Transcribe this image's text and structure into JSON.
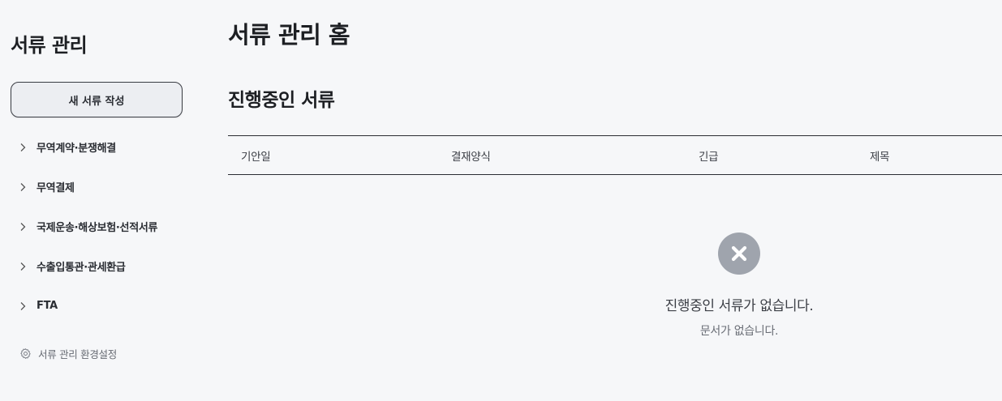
{
  "sidebar": {
    "title": "서류 관리",
    "new_button": "새 서류 작성",
    "items": [
      {
        "label": "무역계약·분쟁해결",
        "icon": "chevron-right-icon"
      },
      {
        "label": "무역결제",
        "icon": "chevron-right-icon"
      },
      {
        "label": "국제운송·해상보험·선적서류",
        "icon": "chevron-right-icon"
      },
      {
        "label": "수출입통관·관세환급",
        "icon": "chevron-right-icon"
      },
      {
        "label": "FTA",
        "icon": "chevron-right-icon"
      }
    ],
    "settings": {
      "label": "서류 관리 환경설정",
      "icon": "gear-icon"
    }
  },
  "main": {
    "page_title": "서류 관리 홈",
    "section_title": "진행중인 서류",
    "table": {
      "columns": [
        "기안일",
        "결재양식",
        "긴급",
        "제목"
      ],
      "rows": []
    },
    "empty_state": {
      "icon": "close-circle-icon",
      "title": "진행중인 서류가 없습니다.",
      "subtitle": "문서가 없습니다."
    }
  },
  "colors": {
    "background": "#f6f7f9",
    "text_primary": "#1d1f23",
    "border": "#2a2d33",
    "empty_icon": "#9fa4ad",
    "button_bg": "#eceef2"
  }
}
